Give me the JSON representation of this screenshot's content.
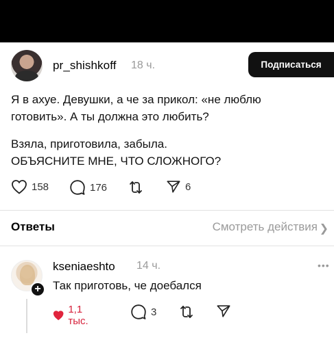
{
  "post": {
    "username": "pr_shishkoff",
    "time": "18 ч.",
    "subscribe_label": "Подписаться",
    "text_para1": "Я в ахуе. Девушки, а че за прикол: «не люблю готовить». А ты должна это любить?",
    "text_para2_line1": "Взяла, приготовила, забыла.",
    "text_para2_line2": "ОБЪЯСНИТЕ МНЕ, ЧТО СЛОЖНОГО?",
    "likes": "158",
    "comments": "176",
    "shares": "6"
  },
  "answers": {
    "title": "Ответы",
    "view_actions": "Смотреть действия"
  },
  "reply": {
    "username": "kseniaeshto",
    "time": "14 ч.",
    "text": "Так приготовь, че доебался",
    "likes": "1,1 тыс.",
    "comments": "3"
  },
  "icons": {
    "like": "heart-icon",
    "comment": "speech-bubble-icon",
    "repost": "repost-icon",
    "share": "send-icon",
    "more": "more-horizontal-icon",
    "chevron": "chevron-right-icon",
    "plus": "plus-icon"
  },
  "colors": {
    "like_active": "#e0243d",
    "muted": "#9a9a9a",
    "button_bg": "#111111"
  }
}
